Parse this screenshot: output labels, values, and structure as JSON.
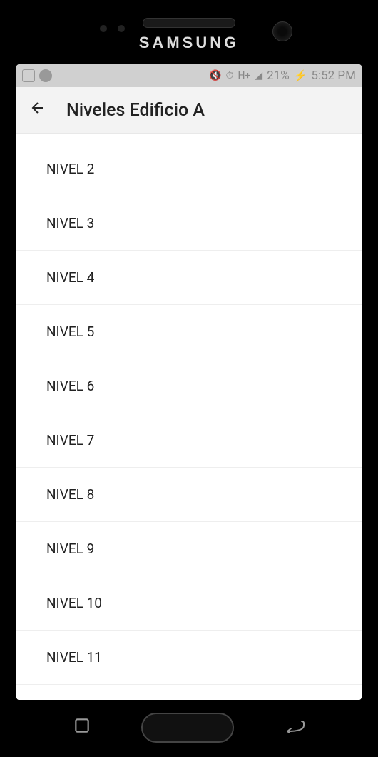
{
  "status_bar": {
    "battery": "21%",
    "charging": "⚡",
    "time": "5:52 PM",
    "mute_icon": "🔇",
    "alarm_icon": "⏰",
    "network_icon": "H+"
  },
  "header": {
    "title": "Niveles Edificio A"
  },
  "levels": [
    {
      "label": "NIVEL 2"
    },
    {
      "label": "NIVEL 3"
    },
    {
      "label": "NIVEL 4"
    },
    {
      "label": "NIVEL 5"
    },
    {
      "label": "NIVEL 6"
    },
    {
      "label": "NIVEL 7"
    },
    {
      "label": "NIVEL 8"
    },
    {
      "label": "NIVEL 9"
    },
    {
      "label": "NIVEL 10"
    },
    {
      "label": "NIVEL 11"
    }
  ]
}
